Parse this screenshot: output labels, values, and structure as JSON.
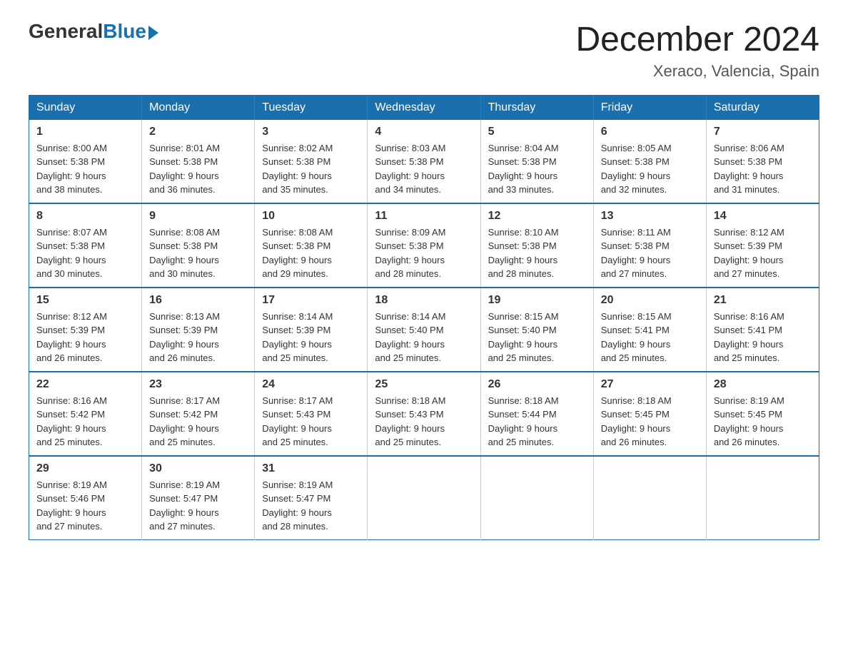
{
  "header": {
    "logo_general": "General",
    "logo_blue": "Blue",
    "month_year": "December 2024",
    "location": "Xeraco, Valencia, Spain"
  },
  "weekdays": [
    "Sunday",
    "Monday",
    "Tuesday",
    "Wednesday",
    "Thursday",
    "Friday",
    "Saturday"
  ],
  "weeks": [
    [
      {
        "day": "1",
        "sunrise": "8:00 AM",
        "sunset": "5:38 PM",
        "daylight": "9 hours and 38 minutes."
      },
      {
        "day": "2",
        "sunrise": "8:01 AM",
        "sunset": "5:38 PM",
        "daylight": "9 hours and 36 minutes."
      },
      {
        "day": "3",
        "sunrise": "8:02 AM",
        "sunset": "5:38 PM",
        "daylight": "9 hours and 35 minutes."
      },
      {
        "day": "4",
        "sunrise": "8:03 AM",
        "sunset": "5:38 PM",
        "daylight": "9 hours and 34 minutes."
      },
      {
        "day": "5",
        "sunrise": "8:04 AM",
        "sunset": "5:38 PM",
        "daylight": "9 hours and 33 minutes."
      },
      {
        "day": "6",
        "sunrise": "8:05 AM",
        "sunset": "5:38 PM",
        "daylight": "9 hours and 32 minutes."
      },
      {
        "day": "7",
        "sunrise": "8:06 AM",
        "sunset": "5:38 PM",
        "daylight": "9 hours and 31 minutes."
      }
    ],
    [
      {
        "day": "8",
        "sunrise": "8:07 AM",
        "sunset": "5:38 PM",
        "daylight": "9 hours and 30 minutes."
      },
      {
        "day": "9",
        "sunrise": "8:08 AM",
        "sunset": "5:38 PM",
        "daylight": "9 hours and 30 minutes."
      },
      {
        "day": "10",
        "sunrise": "8:08 AM",
        "sunset": "5:38 PM",
        "daylight": "9 hours and 29 minutes."
      },
      {
        "day": "11",
        "sunrise": "8:09 AM",
        "sunset": "5:38 PM",
        "daylight": "9 hours and 28 minutes."
      },
      {
        "day": "12",
        "sunrise": "8:10 AM",
        "sunset": "5:38 PM",
        "daylight": "9 hours and 28 minutes."
      },
      {
        "day": "13",
        "sunrise": "8:11 AM",
        "sunset": "5:38 PM",
        "daylight": "9 hours and 27 minutes."
      },
      {
        "day": "14",
        "sunrise": "8:12 AM",
        "sunset": "5:39 PM",
        "daylight": "9 hours and 27 minutes."
      }
    ],
    [
      {
        "day": "15",
        "sunrise": "8:12 AM",
        "sunset": "5:39 PM",
        "daylight": "9 hours and 26 minutes."
      },
      {
        "day": "16",
        "sunrise": "8:13 AM",
        "sunset": "5:39 PM",
        "daylight": "9 hours and 26 minutes."
      },
      {
        "day": "17",
        "sunrise": "8:14 AM",
        "sunset": "5:39 PM",
        "daylight": "9 hours and 25 minutes."
      },
      {
        "day": "18",
        "sunrise": "8:14 AM",
        "sunset": "5:40 PM",
        "daylight": "9 hours and 25 minutes."
      },
      {
        "day": "19",
        "sunrise": "8:15 AM",
        "sunset": "5:40 PM",
        "daylight": "9 hours and 25 minutes."
      },
      {
        "day": "20",
        "sunrise": "8:15 AM",
        "sunset": "5:41 PM",
        "daylight": "9 hours and 25 minutes."
      },
      {
        "day": "21",
        "sunrise": "8:16 AM",
        "sunset": "5:41 PM",
        "daylight": "9 hours and 25 minutes."
      }
    ],
    [
      {
        "day": "22",
        "sunrise": "8:16 AM",
        "sunset": "5:42 PM",
        "daylight": "9 hours and 25 minutes."
      },
      {
        "day": "23",
        "sunrise": "8:17 AM",
        "sunset": "5:42 PM",
        "daylight": "9 hours and 25 minutes."
      },
      {
        "day": "24",
        "sunrise": "8:17 AM",
        "sunset": "5:43 PM",
        "daylight": "9 hours and 25 minutes."
      },
      {
        "day": "25",
        "sunrise": "8:18 AM",
        "sunset": "5:43 PM",
        "daylight": "9 hours and 25 minutes."
      },
      {
        "day": "26",
        "sunrise": "8:18 AM",
        "sunset": "5:44 PM",
        "daylight": "9 hours and 25 minutes."
      },
      {
        "day": "27",
        "sunrise": "8:18 AM",
        "sunset": "5:45 PM",
        "daylight": "9 hours and 26 minutes."
      },
      {
        "day": "28",
        "sunrise": "8:19 AM",
        "sunset": "5:45 PM",
        "daylight": "9 hours and 26 minutes."
      }
    ],
    [
      {
        "day": "29",
        "sunrise": "8:19 AM",
        "sunset": "5:46 PM",
        "daylight": "9 hours and 27 minutes."
      },
      {
        "day": "30",
        "sunrise": "8:19 AM",
        "sunset": "5:47 PM",
        "daylight": "9 hours and 27 minutes."
      },
      {
        "day": "31",
        "sunrise": "8:19 AM",
        "sunset": "5:47 PM",
        "daylight": "9 hours and 28 minutes."
      },
      null,
      null,
      null,
      null
    ]
  ],
  "labels": {
    "sunrise_prefix": "Sunrise: ",
    "sunset_prefix": "Sunset: ",
    "daylight_prefix": "Daylight: "
  }
}
